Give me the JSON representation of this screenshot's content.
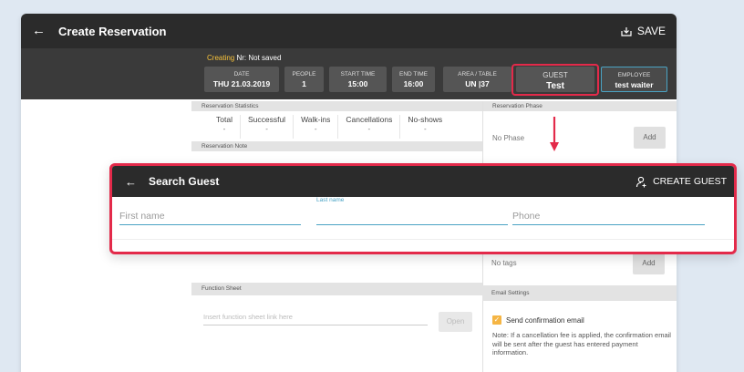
{
  "app": {
    "title": "Create Reservation",
    "back_icon": "arrow-left-icon",
    "save_label": "SAVE",
    "save_icon": "save-icon"
  },
  "header": {
    "creating_label": "Creating",
    "status_text": "Nr: Not saved",
    "chips": {
      "date": {
        "label": "DATE",
        "value": "THU 21.03.2019"
      },
      "people": {
        "label": "PEOPLE",
        "value": "1"
      },
      "start_time": {
        "label": "START TIME",
        "value": "15:00"
      },
      "end_time": {
        "label": "END TIME",
        "value": "16:00"
      },
      "area": {
        "label": "AREA / TABLE",
        "value": "UN |37"
      },
      "guest": {
        "label": "GUEST",
        "value": "Test"
      },
      "employee": {
        "label": "EMPLOYEE",
        "value": "test waiter"
      }
    }
  },
  "statistics": {
    "title": "Reservation Statistics",
    "items": [
      {
        "label": "Total",
        "value": "-"
      },
      {
        "label": "Successful",
        "value": "-"
      },
      {
        "label": "Walk-ins",
        "value": "-"
      },
      {
        "label": "Cancellations",
        "value": "-"
      },
      {
        "label": "No-shows",
        "value": "-"
      }
    ]
  },
  "note": {
    "title": "Reservation Note"
  },
  "phase": {
    "title": "Reservation Phase",
    "value": "No Phase",
    "add_label": "Add"
  },
  "tags": {
    "value": "No tags",
    "add_label": "Add"
  },
  "function_sheet": {
    "title": "Function Sheet",
    "placeholder": "Insert function sheet link here",
    "open_label": "Open"
  },
  "email": {
    "title": "Email Settings",
    "send_label": "Send confirmation email",
    "checked": true,
    "note": "Note: If a cancellation fee is applied, the confirmation email will be sent after the guest has entered payment information."
  },
  "search_guest": {
    "title": "Search Guest",
    "create_label": "CREATE GUEST",
    "create_icon": "add-person-icon",
    "first_name_placeholder": "First name",
    "last_name_label": "Last name",
    "phone_placeholder": "Phone"
  },
  "colors": {
    "accent": "#4aa3c4",
    "highlight": "#e32a4a",
    "creating": "#f7c23a",
    "checkbox": "#f5b544"
  }
}
